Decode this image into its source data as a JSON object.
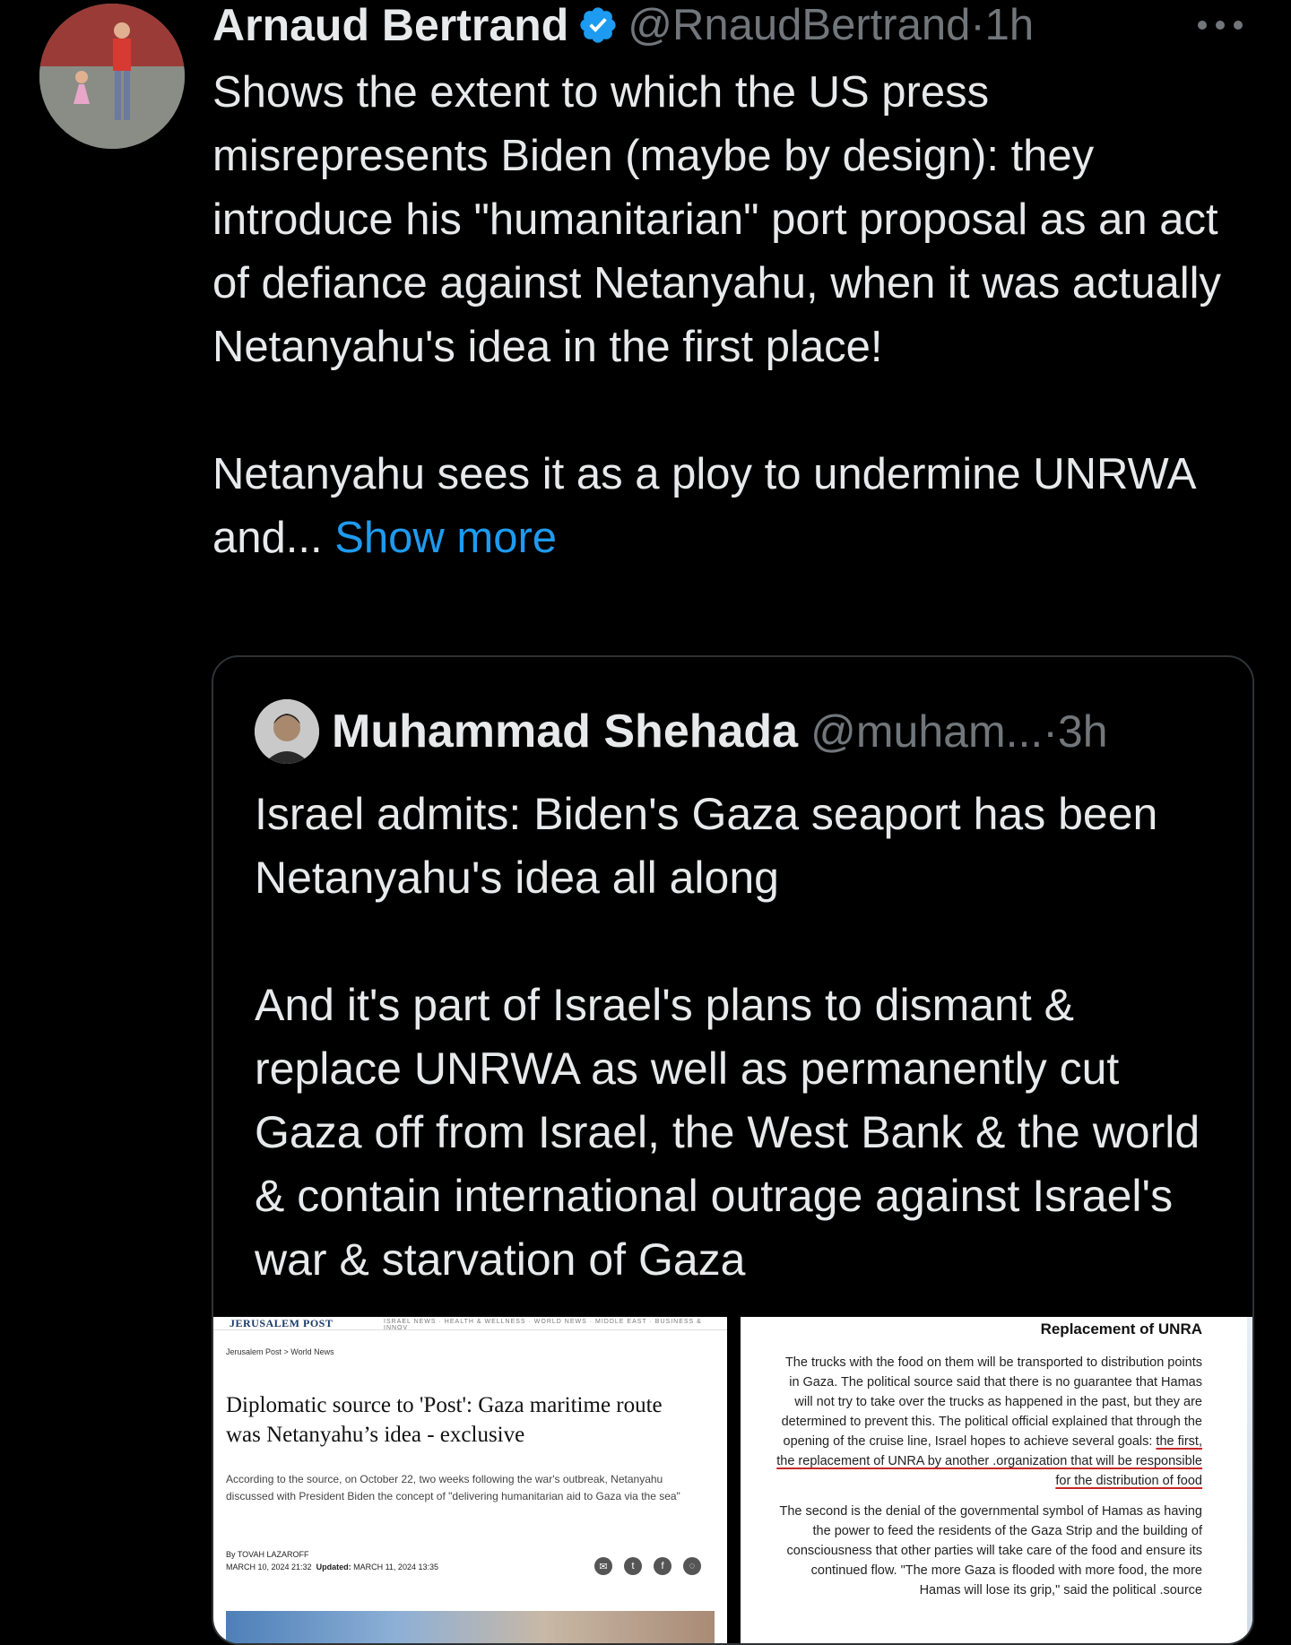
{
  "tweet": {
    "author_name": "Arnaud Bertrand",
    "handle": "@RnaudBertrand",
    "time": "1h",
    "verified": true,
    "text_paragraph_1": "Shows the extent to which the US press misrepresents Biden (maybe by design): they introduce his \"humanitarian\" port proposal as an act of defiance against Netanyahu, when it was actually Netanyahu's idea in the first place!",
    "text_paragraph_2": "Netanyahu sees it as a ploy to undermine UNRWA and... ",
    "show_more_label": "Show more"
  },
  "quote": {
    "author_name": "Muhammad Shehada",
    "handle": "@muham...",
    "time": "3h",
    "text_paragraph_1": "Israel admits: Biden's Gaza seaport has been Netanyahu's idea all along",
    "text_paragraph_2": "And it's part of Israel's plans to dismant & replace UNRWA as well as permanently cut Gaza off from Israel, the West Bank & the world & contain international outrage against Israel's war & starvation of Gaza"
  },
  "image_left": {
    "logo": "JERUSALEM POST",
    "nav": "ISRAEL NEWS · HEALTH & WELLNESS · WORLD NEWS · MIDDLE EAST · BUSINESS & INNOV",
    "breadcrumb": "Jerusalem Post > World News",
    "headline": "Diplomatic source to 'Post': Gaza maritime route was Netanyahu’s idea - exclusive",
    "summary": "According to the source, on October 22, two weeks following the war's outbreak, Netanyahu discussed with President Biden the concept of \"delivering humanitarian aid to Gaza via the sea\"",
    "byline": "By TOVAH LAZAROFF",
    "date": "MARCH 10, 2024 21:32",
    "updated_label": "Updated:",
    "updated_date": "MARCH 11, 2024 13:35"
  },
  "image_right": {
    "title": "Replacement of UNRA",
    "paragraph_1_plain": "The trucks with the food on them will be transported to distribution points in Gaza. The political source said that there is no guarantee that Hamas will not try to take over the trucks as happened in the past, but they are determined to prevent this. The political official explained that through the opening of the cruise line, Israel hopes to achieve several goals: ",
    "paragraph_1_underlined": "the first, the replacement of UNRA by another .organization that will be responsible for the distribution of food",
    "paragraph_2": "The second is the denial of the governmental symbol of Hamas as having the power to feed the residents of the Gaza Strip and the building of consciousness that other parties will take care of the food and ensure its continued flow. \"The more Gaza is flooded with more food, the more Hamas will lose its grip,\" said the political .source"
  },
  "colors": {
    "background": "#000000",
    "text": "#e7e9ea",
    "muted": "#71767b",
    "link": "#1d9bf0",
    "verified": "#1d9bf0",
    "border": "#2f3336"
  }
}
